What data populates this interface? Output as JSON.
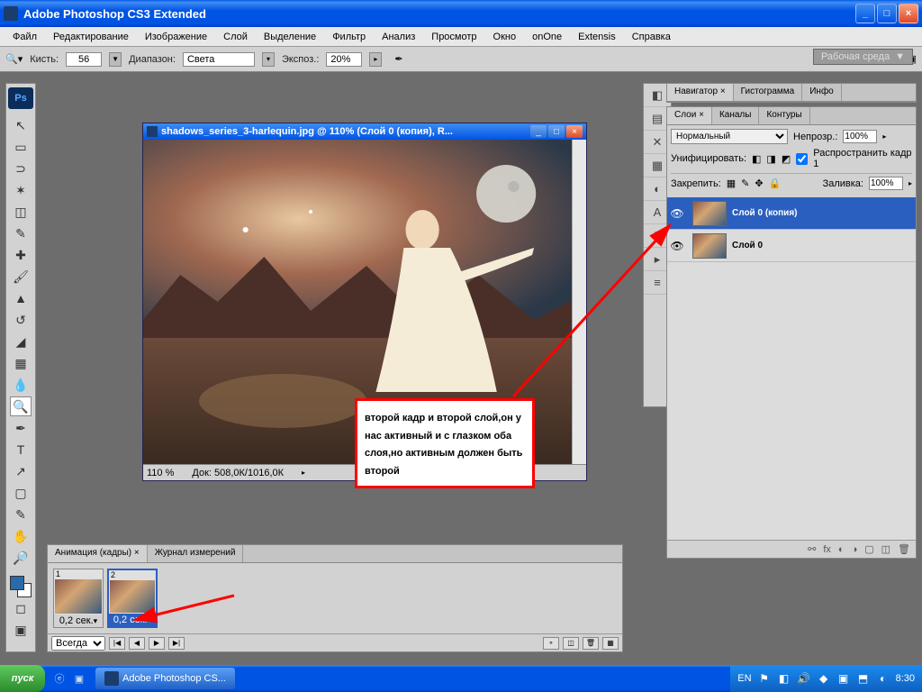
{
  "app": {
    "title": "Adobe Photoshop CS3 Extended",
    "ps_logo": "Ps"
  },
  "menu": [
    "Файл",
    "Редактирование",
    "Изображение",
    "Слой",
    "Выделение",
    "Фильтр",
    "Анализ",
    "Просмотр",
    "Окно",
    "onOne",
    "Extensis",
    "Справка"
  ],
  "options": {
    "brush_label": "Кисть:",
    "brush_size": "56",
    "range_label": "Диапазон:",
    "range_value": "Света",
    "exposure_label": "Экспоз.:",
    "exposure_value": "20%",
    "workspace_label": "Рабочая среда"
  },
  "document": {
    "title": "shadows_series_3-harlequin.jpg @ 110% (Слой 0 (копия), R...",
    "zoom": "110 %",
    "status": "Док: 508,0К/1016,0К"
  },
  "annotation": {
    "text": "второй кадр и второй слой,он у нас активный и с глазком оба слоя,но активным должен быть второй"
  },
  "panels": {
    "navigator": {
      "tabs": [
        "Навигатор ×",
        "Гистограмма",
        "Инфо"
      ]
    },
    "layers": {
      "tabs": [
        "Слои ×",
        "Каналы",
        "Контуры"
      ],
      "blend_mode": "Нормальный",
      "opacity_label": "Непрозр.:",
      "opacity": "100%",
      "unify_label": "Унифицировать:",
      "propagate_label": "Распространить кадр 1",
      "lock_label": "Закрепить:",
      "fill_label": "Заливка:",
      "fill": "100%",
      "items": [
        {
          "name": "Слой 0 (копия)",
          "visible": true,
          "active": true
        },
        {
          "name": "Слой 0",
          "visible": true,
          "active": false
        }
      ]
    }
  },
  "animation": {
    "tabs": [
      "Анимация (кадры) ×",
      "Журнал измерений"
    ],
    "frames": [
      {
        "num": "1",
        "time": "0,2 сек.",
        "active": false
      },
      {
        "num": "2",
        "time": "0,2 сек.",
        "active": true
      }
    ],
    "loop": "Всегда"
  },
  "taskbar": {
    "start": "пуск",
    "item": "Adobe Photoshop CS...",
    "lang": "EN",
    "time": "8:30"
  },
  "colors": {
    "fg": "#2a6aa8"
  }
}
